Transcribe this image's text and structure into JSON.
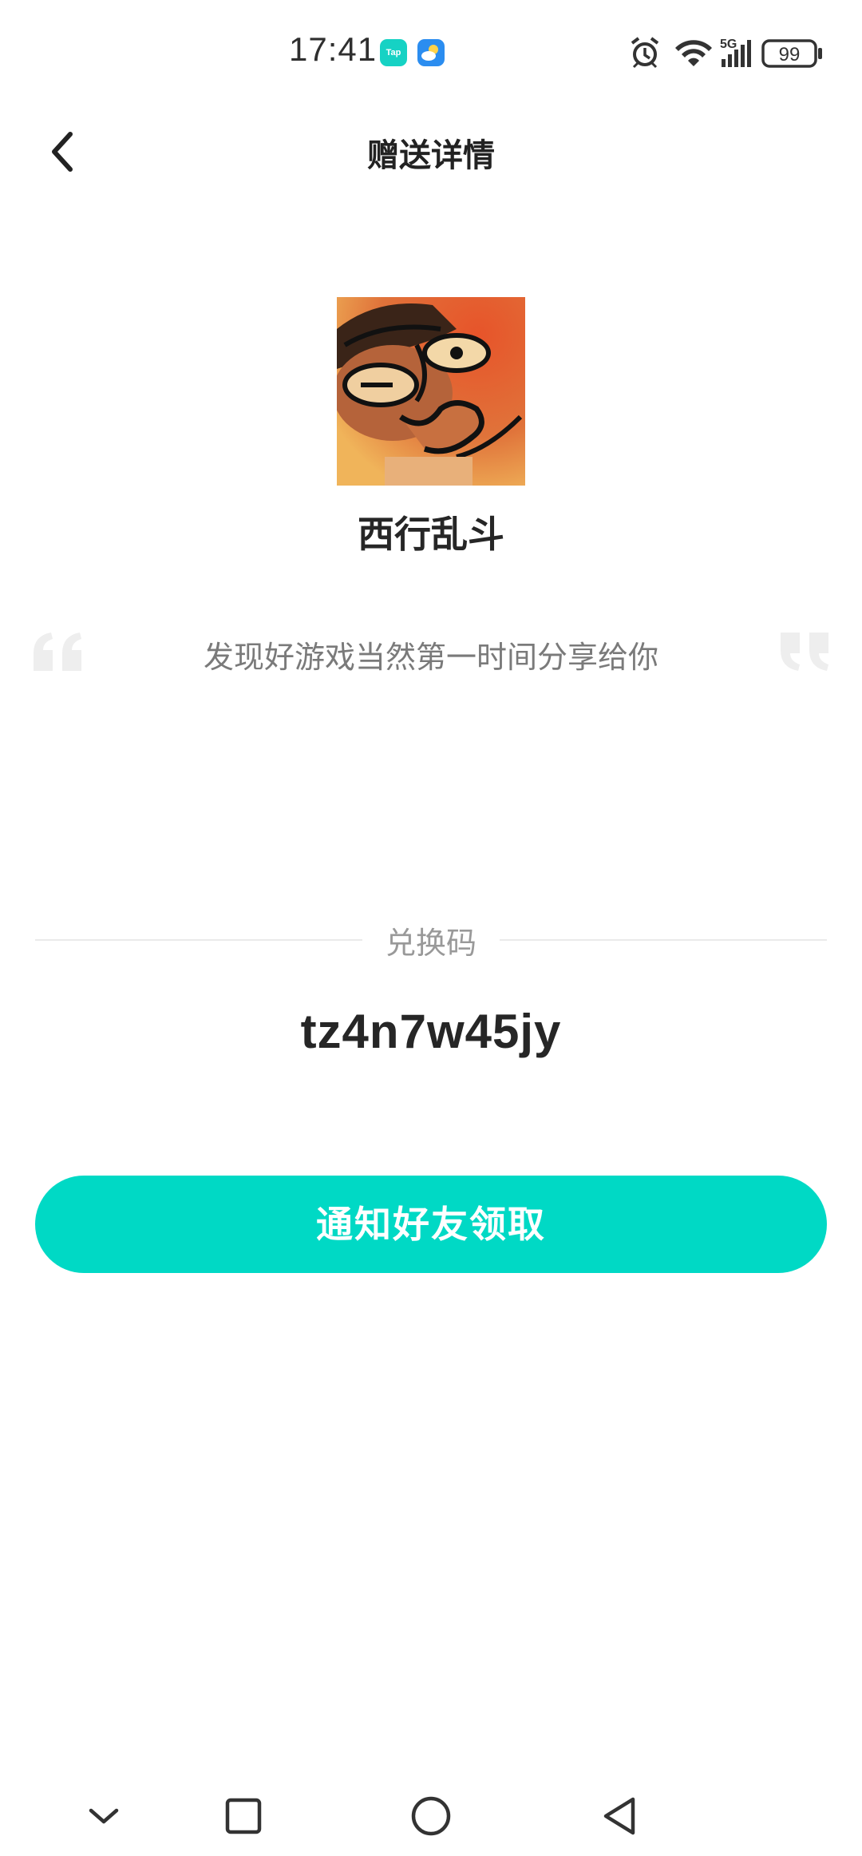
{
  "status_bar": {
    "time": "17:41",
    "tap_badge_text": "Tap",
    "battery": "99",
    "network": "5G",
    "icons": [
      "alarm-icon",
      "wifi-icon",
      "signal-icon",
      "battery-icon"
    ]
  },
  "header": {
    "title": "赠送详情",
    "back_icon": "chevron-left-icon"
  },
  "game": {
    "name": "西行乱斗",
    "icon": "game-cover-image"
  },
  "message": {
    "text": "发现好游戏当然第一时间分享给你"
  },
  "code_section": {
    "label": "兑换码",
    "code": "tz4n7w45jy"
  },
  "action": {
    "notify_label": "通知好友领取"
  },
  "system_nav": {
    "icons": [
      "chevron-down-icon",
      "square-icon",
      "circle-icon",
      "triangle-back-icon"
    ]
  },
  "colors": {
    "accent": "#00d9c5",
    "text_primary": "#262626",
    "text_secondary": "#7a7a7a",
    "quote": "#eeeeee"
  }
}
